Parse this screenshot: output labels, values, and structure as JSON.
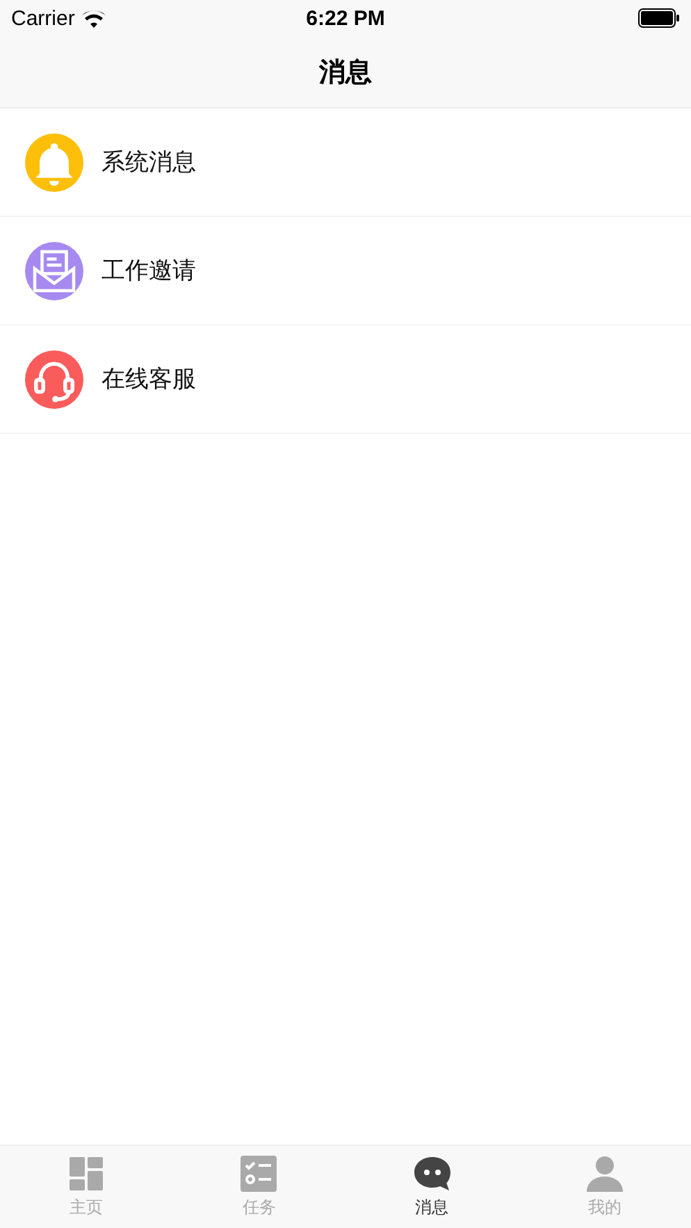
{
  "status_bar": {
    "carrier": "Carrier",
    "time": "6:22 PM"
  },
  "nav_bar": {
    "title": "消息"
  },
  "items": [
    {
      "label": "系统消息",
      "kind": "bell",
      "color": "#fdbf0a"
    },
    {
      "label": "工作邀请",
      "kind": "mail",
      "color": "#a68af0"
    },
    {
      "label": "在线客服",
      "kind": "headset",
      "color": "#fa5b5b"
    }
  ],
  "tab_bar": [
    {
      "label": "主页",
      "kind": "home",
      "selected": false
    },
    {
      "label": "任务",
      "kind": "tasks",
      "selected": false
    },
    {
      "label": "消息",
      "kind": "chat",
      "selected": true
    },
    {
      "label": "我的",
      "kind": "person",
      "selected": false
    }
  ]
}
